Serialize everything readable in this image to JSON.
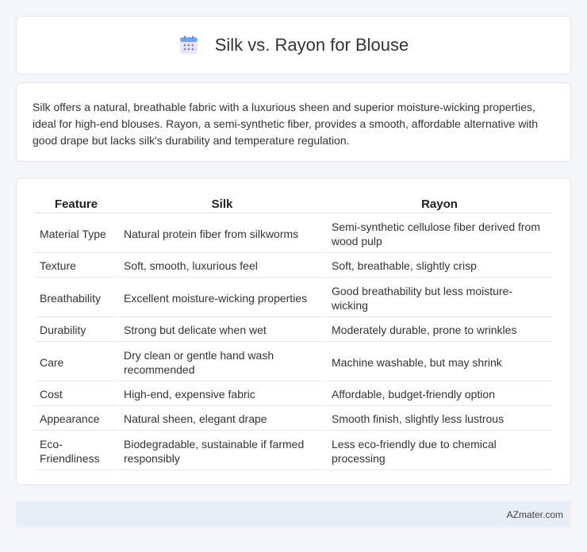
{
  "header": {
    "title": "Silk vs. Rayon for Blouse",
    "icon": "calendar-icon"
  },
  "summary": {
    "text": "Silk offers a natural, breathable fabric with a luxurious sheen and superior moisture-wicking properties, ideal for high-end blouses. Rayon, a semi-synthetic fiber, provides a smooth, affordable alternative with good drape but lacks silk's durability and temperature regulation."
  },
  "table": {
    "headers": [
      "Feature",
      "Silk",
      "Rayon"
    ],
    "rows": [
      [
        "Material Type",
        "Natural protein fiber from silkworms",
        "Semi-synthetic cellulose fiber derived from wood pulp"
      ],
      [
        "Texture",
        "Soft, smooth, luxurious feel",
        "Soft, breathable, slightly crisp"
      ],
      [
        "Breathability",
        "Excellent moisture-wicking properties",
        "Good breathability but less moisture-wicking"
      ],
      [
        "Durability",
        "Strong but delicate when wet",
        "Moderately durable, prone to wrinkles"
      ],
      [
        "Care",
        "Dry clean or gentle hand wash recommended",
        "Machine washable, but may shrink"
      ],
      [
        "Cost",
        "High-end, expensive fabric",
        "Affordable, budget-friendly option"
      ],
      [
        "Appearance",
        "Natural sheen, elegant drape",
        "Smooth finish, slightly less lustrous"
      ],
      [
        "Eco-Friendliness",
        "Biodegradable, sustainable if farmed responsibly",
        "Less eco-friendly due to chemical processing"
      ]
    ]
  },
  "footer": {
    "text": "AZmater.com"
  },
  "colors": {
    "background": "#f4f6fa",
    "card": "#ffffff",
    "footer": "#e8eef8",
    "icon_accent": "#7b6fd6"
  }
}
